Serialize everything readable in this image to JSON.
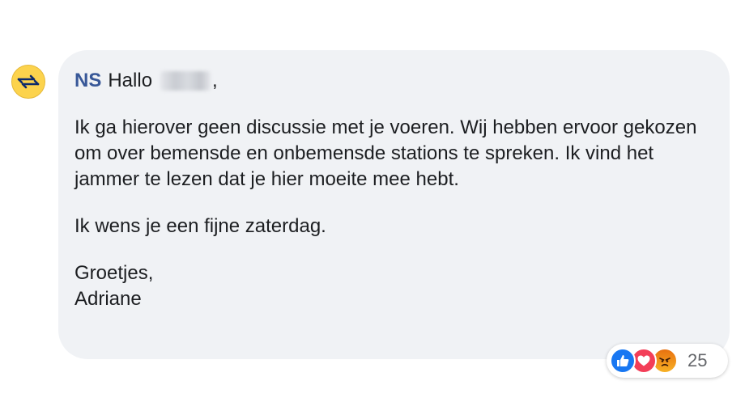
{
  "comment": {
    "author": "NS",
    "greeting": "Hallo",
    "greeting_punct": ",",
    "paragraphs": [
      "Ik ga hierover geen discussie met je voeren. Wij hebben ervoor gekozen om over bemensde en onbemensde stations te spreken. Ik vind het jammer te lezen dat je hier moeite mee hebt.",
      "Ik wens je een fijne zaterdag.",
      "Groetjes,",
      "Adriane"
    ]
  },
  "reactions": {
    "icons": [
      "like-icon",
      "love-icon",
      "angry-icon"
    ],
    "count": "25"
  },
  "colors": {
    "author": "#385898",
    "bubble": "#f0f2f5",
    "avatar": "#fcd34d",
    "like": "#1877f2",
    "love": "#f33e58",
    "angry": "#e9710f"
  }
}
